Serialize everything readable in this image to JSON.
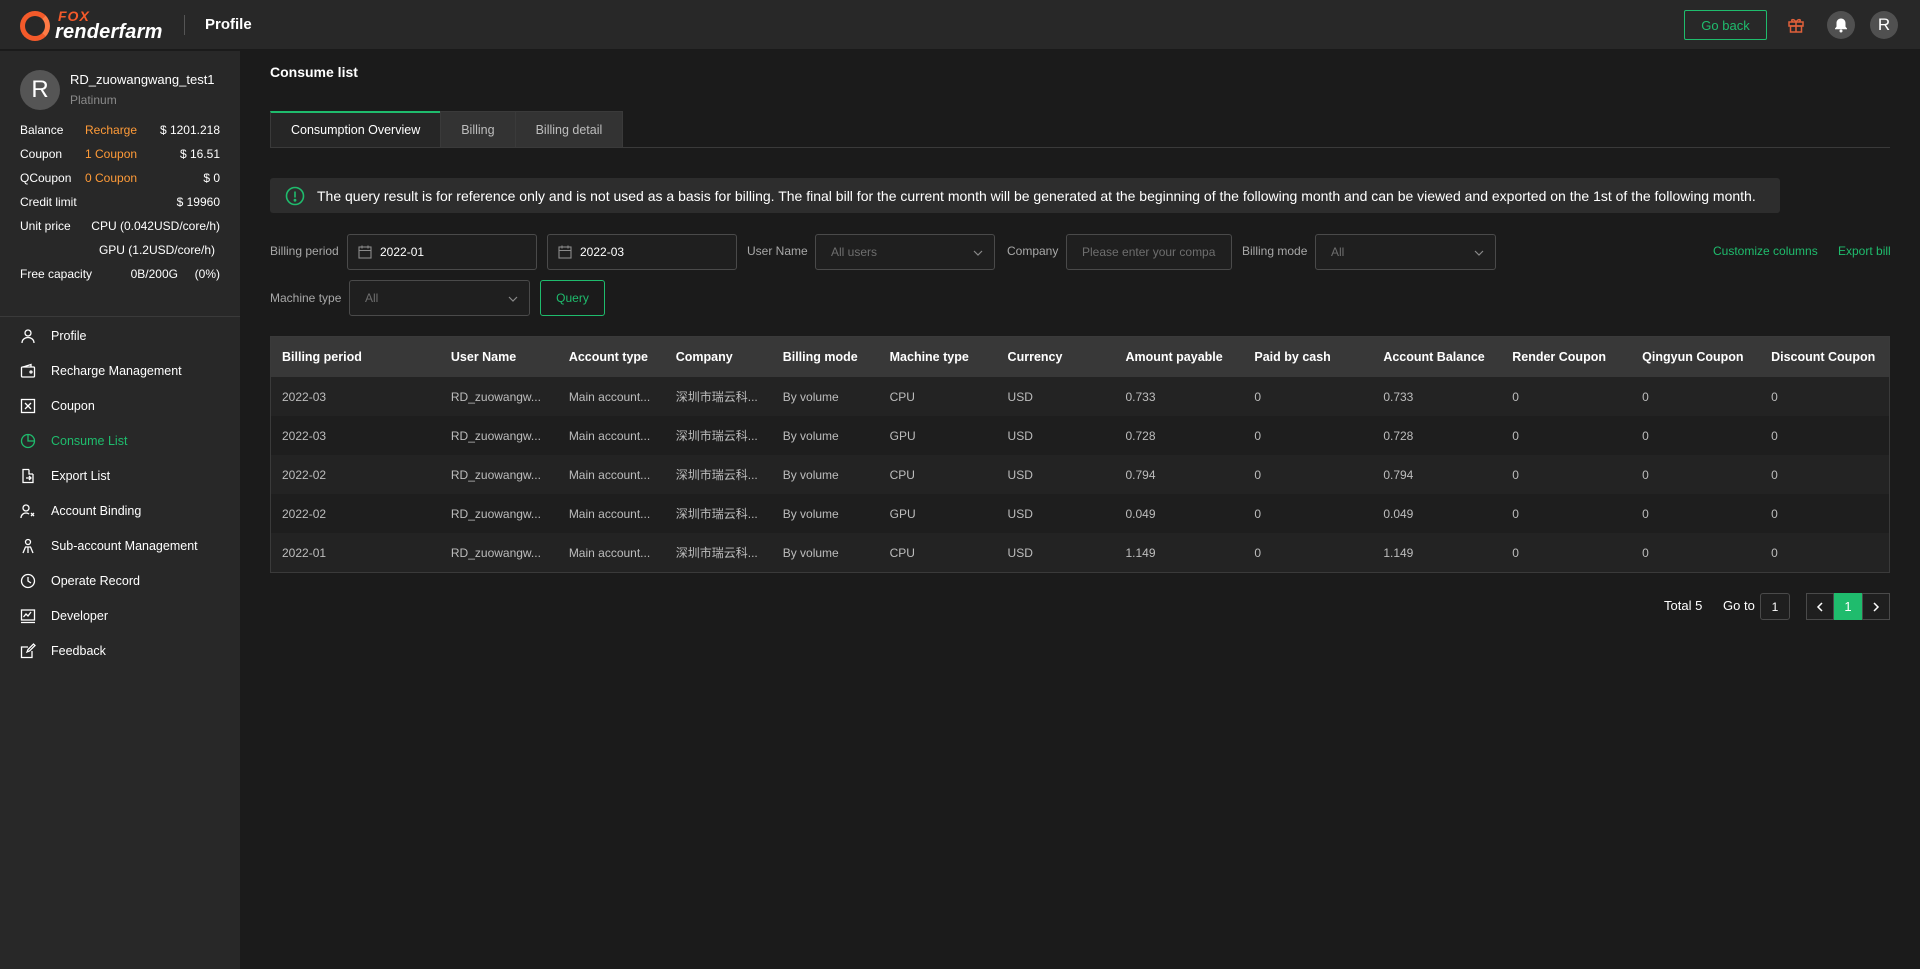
{
  "header": {
    "logo_top": "FOX",
    "logo_bottom": "renderfarm",
    "title": "Profile",
    "go_back": "Go back",
    "avatar_letter": "R"
  },
  "sidebar": {
    "avatar_letter": "R",
    "username": "RD_zuowangwang_test1",
    "level": "Platinum",
    "balance": {
      "label": "Balance",
      "action": "Recharge",
      "value": "$ 1201.218"
    },
    "coupon": {
      "label": "Coupon",
      "action": "1 Coupon",
      "value": "$ 16.51"
    },
    "qcoupon": {
      "label": "QCoupon",
      "action": "0 Coupon",
      "value": "$ 0"
    },
    "credit": {
      "label": "Credit limit",
      "value": "$ 19960"
    },
    "unit_price": {
      "label": "Unit price",
      "cpu": "CPU (0.042USD/core/h)",
      "gpu": "GPU (1.2USD/core/h)"
    },
    "free_capacity": {
      "label": "Free capacity",
      "value": "0B/200G",
      "percent": "(0%)"
    },
    "menu": [
      {
        "label": "Profile",
        "icon": "user-icon"
      },
      {
        "label": "Recharge Management",
        "icon": "wallet-icon"
      },
      {
        "label": "Coupon",
        "icon": "coupon-icon"
      },
      {
        "label": "Consume List",
        "icon": "pie-chart-icon"
      },
      {
        "label": "Export List",
        "icon": "export-icon"
      },
      {
        "label": "Account Binding",
        "icon": "link-icon"
      },
      {
        "label": "Sub-account Management",
        "icon": "users-icon"
      },
      {
        "label": "Operate Record",
        "icon": "clock-icon"
      },
      {
        "label": "Developer",
        "icon": "code-icon"
      },
      {
        "label": "Feedback",
        "icon": "feedback-icon"
      }
    ]
  },
  "main": {
    "title": "Consume list",
    "tabs": [
      "Consumption Overview",
      "Billing",
      "Billing detail"
    ],
    "notice": "The query result is for reference only and is not used as a basis for billing. The final bill for the current month will be generated at the beginning of the following month and can be viewed and exported on the 1st of the following month.",
    "filters": {
      "billing_period_label": "Billing period",
      "period_start": "2022-01",
      "period_end": "2022-03",
      "user_name_label": "User Name",
      "user_name_placeholder": "All users",
      "company_label": "Company",
      "company_placeholder": "Please enter your compa",
      "billing_mode_label": "Billing mode",
      "billing_mode_value": "All",
      "machine_type_label": "Machine type",
      "machine_type_value": "All",
      "query": "Query",
      "customize_columns": "Customize columns",
      "export_bill": "Export bill"
    },
    "table": {
      "columns": [
        "Billing period",
        "User Name",
        "Account type",
        "Company",
        "Billing mode",
        "Machine type",
        "Currency",
        "Amount payable",
        "Paid by cash",
        "Account Balance",
        "Render Coupon",
        "Qingyun Coupon",
        "Discount Coupon"
      ],
      "rows": [
        [
          "2022-03",
          "RD_zuowangw...",
          "Main account...",
          "深圳市瑞云科...",
          "By volume",
          "CPU",
          "USD",
          "0.733",
          "0",
          "0.733",
          "0",
          "0",
          "0"
        ],
        [
          "2022-03",
          "RD_zuowangw...",
          "Main account...",
          "深圳市瑞云科...",
          "By volume",
          "GPU",
          "USD",
          "0.728",
          "0",
          "0.728",
          "0",
          "0",
          "0"
        ],
        [
          "2022-02",
          "RD_zuowangw...",
          "Main account...",
          "深圳市瑞云科...",
          "By volume",
          "CPU",
          "USD",
          "0.794",
          "0",
          "0.794",
          "0",
          "0",
          "0"
        ],
        [
          "2022-02",
          "RD_zuowangw...",
          "Main account...",
          "深圳市瑞云科...",
          "By volume",
          "GPU",
          "USD",
          "0.049",
          "0",
          "0.049",
          "0",
          "0",
          "0"
        ],
        [
          "2022-01",
          "RD_zuowangw...",
          "Main account...",
          "深圳市瑞云科...",
          "By volume",
          "CPU",
          "USD",
          "1.149",
          "0",
          "1.149",
          "0",
          "0",
          "0"
        ]
      ]
    },
    "pagination": {
      "total": "Total 5",
      "goto_label": "Go to",
      "goto_value": "1",
      "current_page": "1"
    }
  },
  "colors": {
    "accent": "#1fbc6d",
    "brand": "#f45a2a",
    "highlight": "#ff9b38"
  }
}
